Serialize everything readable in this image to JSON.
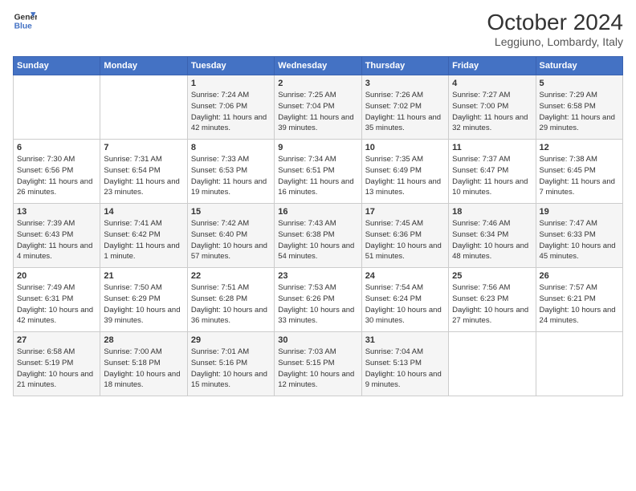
{
  "header": {
    "logo_line1": "General",
    "logo_line2": "Blue",
    "title": "October 2024",
    "subtitle": "Leggiuno, Lombardy, Italy"
  },
  "days_of_week": [
    "Sunday",
    "Monday",
    "Tuesday",
    "Wednesday",
    "Thursday",
    "Friday",
    "Saturday"
  ],
  "weeks": [
    [
      {
        "day": "",
        "info": ""
      },
      {
        "day": "",
        "info": ""
      },
      {
        "day": "1",
        "info": "Sunrise: 7:24 AM\nSunset: 7:06 PM\nDaylight: 11 hours and 42 minutes."
      },
      {
        "day": "2",
        "info": "Sunrise: 7:25 AM\nSunset: 7:04 PM\nDaylight: 11 hours and 39 minutes."
      },
      {
        "day": "3",
        "info": "Sunrise: 7:26 AM\nSunset: 7:02 PM\nDaylight: 11 hours and 35 minutes."
      },
      {
        "day": "4",
        "info": "Sunrise: 7:27 AM\nSunset: 7:00 PM\nDaylight: 11 hours and 32 minutes."
      },
      {
        "day": "5",
        "info": "Sunrise: 7:29 AM\nSunset: 6:58 PM\nDaylight: 11 hours and 29 minutes."
      }
    ],
    [
      {
        "day": "6",
        "info": "Sunrise: 7:30 AM\nSunset: 6:56 PM\nDaylight: 11 hours and 26 minutes."
      },
      {
        "day": "7",
        "info": "Sunrise: 7:31 AM\nSunset: 6:54 PM\nDaylight: 11 hours and 23 minutes."
      },
      {
        "day": "8",
        "info": "Sunrise: 7:33 AM\nSunset: 6:53 PM\nDaylight: 11 hours and 19 minutes."
      },
      {
        "day": "9",
        "info": "Sunrise: 7:34 AM\nSunset: 6:51 PM\nDaylight: 11 hours and 16 minutes."
      },
      {
        "day": "10",
        "info": "Sunrise: 7:35 AM\nSunset: 6:49 PM\nDaylight: 11 hours and 13 minutes."
      },
      {
        "day": "11",
        "info": "Sunrise: 7:37 AM\nSunset: 6:47 PM\nDaylight: 11 hours and 10 minutes."
      },
      {
        "day": "12",
        "info": "Sunrise: 7:38 AM\nSunset: 6:45 PM\nDaylight: 11 hours and 7 minutes."
      }
    ],
    [
      {
        "day": "13",
        "info": "Sunrise: 7:39 AM\nSunset: 6:43 PM\nDaylight: 11 hours and 4 minutes."
      },
      {
        "day": "14",
        "info": "Sunrise: 7:41 AM\nSunset: 6:42 PM\nDaylight: 11 hours and 1 minute."
      },
      {
        "day": "15",
        "info": "Sunrise: 7:42 AM\nSunset: 6:40 PM\nDaylight: 10 hours and 57 minutes."
      },
      {
        "day": "16",
        "info": "Sunrise: 7:43 AM\nSunset: 6:38 PM\nDaylight: 10 hours and 54 minutes."
      },
      {
        "day": "17",
        "info": "Sunrise: 7:45 AM\nSunset: 6:36 PM\nDaylight: 10 hours and 51 minutes."
      },
      {
        "day": "18",
        "info": "Sunrise: 7:46 AM\nSunset: 6:34 PM\nDaylight: 10 hours and 48 minutes."
      },
      {
        "day": "19",
        "info": "Sunrise: 7:47 AM\nSunset: 6:33 PM\nDaylight: 10 hours and 45 minutes."
      }
    ],
    [
      {
        "day": "20",
        "info": "Sunrise: 7:49 AM\nSunset: 6:31 PM\nDaylight: 10 hours and 42 minutes."
      },
      {
        "day": "21",
        "info": "Sunrise: 7:50 AM\nSunset: 6:29 PM\nDaylight: 10 hours and 39 minutes."
      },
      {
        "day": "22",
        "info": "Sunrise: 7:51 AM\nSunset: 6:28 PM\nDaylight: 10 hours and 36 minutes."
      },
      {
        "day": "23",
        "info": "Sunrise: 7:53 AM\nSunset: 6:26 PM\nDaylight: 10 hours and 33 minutes."
      },
      {
        "day": "24",
        "info": "Sunrise: 7:54 AM\nSunset: 6:24 PM\nDaylight: 10 hours and 30 minutes."
      },
      {
        "day": "25",
        "info": "Sunrise: 7:56 AM\nSunset: 6:23 PM\nDaylight: 10 hours and 27 minutes."
      },
      {
        "day": "26",
        "info": "Sunrise: 7:57 AM\nSunset: 6:21 PM\nDaylight: 10 hours and 24 minutes."
      }
    ],
    [
      {
        "day": "27",
        "info": "Sunrise: 6:58 AM\nSunset: 5:19 PM\nDaylight: 10 hours and 21 minutes."
      },
      {
        "day": "28",
        "info": "Sunrise: 7:00 AM\nSunset: 5:18 PM\nDaylight: 10 hours and 18 minutes."
      },
      {
        "day": "29",
        "info": "Sunrise: 7:01 AM\nSunset: 5:16 PM\nDaylight: 10 hours and 15 minutes."
      },
      {
        "day": "30",
        "info": "Sunrise: 7:03 AM\nSunset: 5:15 PM\nDaylight: 10 hours and 12 minutes."
      },
      {
        "day": "31",
        "info": "Sunrise: 7:04 AM\nSunset: 5:13 PM\nDaylight: 10 hours and 9 minutes."
      },
      {
        "day": "",
        "info": ""
      },
      {
        "day": "",
        "info": ""
      }
    ]
  ]
}
